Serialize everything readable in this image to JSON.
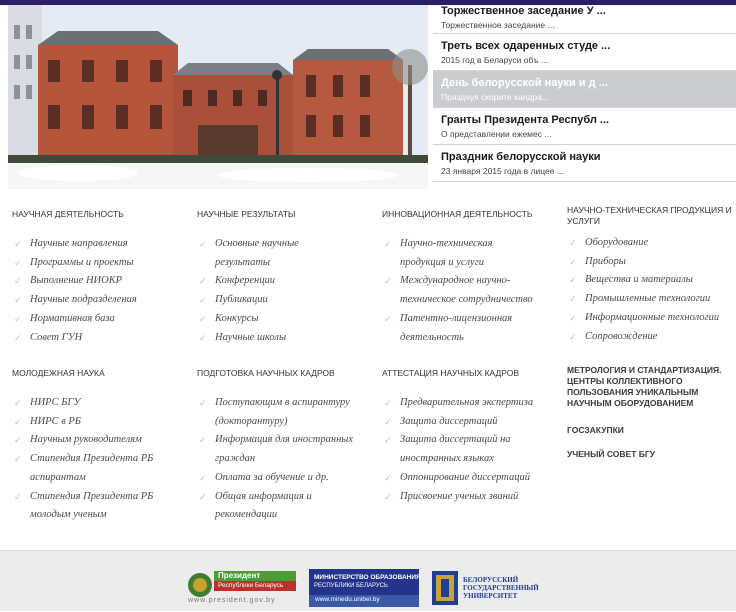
{
  "news": [
    {
      "title": "Торжественное заседание У ...",
      "subtitle": "Торжественное заседание ..."
    },
    {
      "title": "Треть всех одаренных студе ...",
      "subtitle": "2015 год в Беларуси объ ..."
    },
    {
      "title": "День белорусской науки и д ...",
      "subtitle": "Празднуя скорите кандра..."
    },
    {
      "title": "Гранты Президента Республ ...",
      "subtitle": "О представлении ежемес ..."
    },
    {
      "title": "Праздник белорусской науки",
      "subtitle": "23 января 2015 года в лицее ..."
    }
  ],
  "sections": [
    {
      "title": "НАУЧНАЯ ДЕЯТЕЛЬНОСТЬ",
      "items": [
        "Научные направления",
        "Программы и проекты",
        "Выполнение НИОКР",
        "Научные подразделения",
        "Нормативная база",
        "Совет ГУН"
      ]
    },
    {
      "title": "НАУЧНЫЕ РЕЗУЛЬТАТЫ",
      "items": [
        "Основные научные",
        "результаты",
        "Конференции",
        "Публикации",
        "Конкурсы",
        "Научные школы"
      ]
    },
    {
      "title": "ИННОВАЦИОННАЯ ДЕЯТЕЛЬНОСТЬ",
      "items": [
        "Научно-техническая",
        "продукция и услуги",
        "Международное научно-",
        "техническое сотрудничество",
        "Патентно-лицензионная",
        "деятельность"
      ]
    },
    {
      "title": "НАУЧНО-ТЕХНИЧЕСКАЯ ПРОДУКЦИЯ И УСЛУГИ",
      "items": [
        "Оборудование",
        "Приборы",
        "Вещества и материалы",
        "Промышленные технологии",
        "Информационные технологии",
        "Сопровождение"
      ]
    },
    {
      "title": "МОЛОДЕЖНАЯ НАУКА",
      "items": [
        "НИРС БГУ",
        "НИРС в РБ",
        "Научным руководителям",
        "Стипендия Президента РБ",
        "аспирантам",
        "Стипендия Президента РБ",
        "молодым ученым"
      ]
    },
    {
      "title": "ПОДГОТОВКА НАУЧНЫХ КАДРОВ",
      "items": [
        "Поступающим в аспирантуру",
        "(докторантуру)",
        "Информация для иностранных",
        "граждан",
        "Оплата за обучение и др.",
        "Общая информация и",
        "рекомендации"
      ]
    },
    {
      "title": "АТТЕСТАЦИЯ НАУЧНЫХ КАДРОВ",
      "items": [
        "Предварительная экспертиза",
        "Защита диссертаций",
        "Защита диссертаций на",
        "иностранных языках",
        "Оппонирование диссертаций",
        "Присвоение ученых званий"
      ]
    }
  ],
  "extra_links": [
    "МЕТРОЛОГИЯ И СТАНДАРТИЗАЦИЯ. ЦЕНТРЫ КОЛЛЕКТИВНОГО ПОЛЬЗОВАНИЯ УНИКАЛЬНЫМ НАУЧНЫМ ОБОРУДОВАНИЕМ",
    "ГОСЗАКУПКИ",
    "УЧЕНЫЙ СОВЕТ БГУ"
  ],
  "footer": {
    "president": {
      "line1": "Президент",
      "line2": "Республики Беларусь",
      "url": "www.president.gov.by"
    },
    "ministry": {
      "line1": "МИНИСТЕРСТВО ОБРАЗОВАНИЯ",
      "line2": "РЕСПУБЛИКИ БЕЛАРУСЬ",
      "url": "www.minedu.unibel.by"
    },
    "university": {
      "line1": "БЕЛОРУССКИЙ",
      "line2": "ГОСУДАРСТВЕННЫЙ",
      "line3": "УНИВЕРСИТЕТ"
    }
  },
  "colors": {
    "topbar": "#2b1f6b",
    "active_news": "#c9cdd2",
    "brick": "#b4553c"
  }
}
